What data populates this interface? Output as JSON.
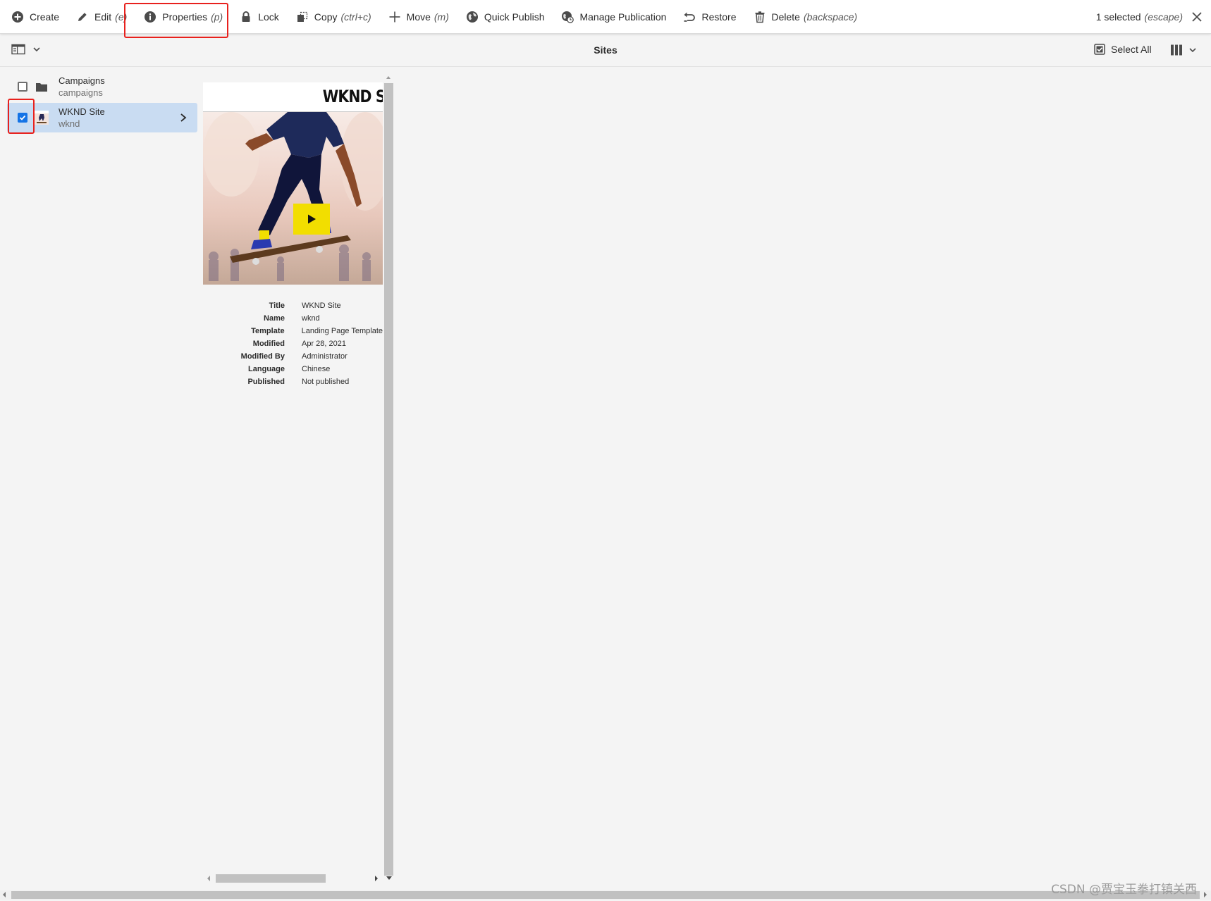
{
  "actionbar": {
    "actions": [
      {
        "label": "Create",
        "hint": ""
      },
      {
        "label": "Edit",
        "hint": "(e)"
      },
      {
        "label": "Properties",
        "hint": "(p)"
      },
      {
        "label": "Lock",
        "hint": ""
      },
      {
        "label": "Copy",
        "hint": "(ctrl+c)"
      },
      {
        "label": "Move",
        "hint": "(m)"
      },
      {
        "label": "Quick Publish",
        "hint": ""
      },
      {
        "label": "Manage Publication",
        "hint": ""
      },
      {
        "label": "Restore",
        "hint": ""
      },
      {
        "label": "Delete",
        "hint": "(backspace)"
      }
    ],
    "selection": {
      "label": "1 selected",
      "hint": "(escape)"
    }
  },
  "titlebar": {
    "title": "Sites",
    "select_all": "Select All"
  },
  "column": {
    "items": [
      {
        "title": "Campaigns",
        "subtitle": "campaigns",
        "checked": false,
        "icon": "folder-icon"
      },
      {
        "title": "WKND Site",
        "subtitle": "wknd",
        "checked": true,
        "icon": "site-thumbnail-icon"
      }
    ]
  },
  "preview": {
    "logo_text": "WKND S",
    "properties": [
      {
        "label": "Title",
        "value": "WKND Site"
      },
      {
        "label": "Name",
        "value": "wknd"
      },
      {
        "label": "Template",
        "value": "Landing Page Template"
      },
      {
        "label": "Modified",
        "value": "Apr 28, 2021"
      },
      {
        "label": "Modified By",
        "value": "Administrator"
      },
      {
        "label": "Language",
        "value": "Chinese"
      },
      {
        "label": "Published",
        "value": "Not published"
      }
    ]
  },
  "watermark": "CSDN @贾宝玉拳打镇关西",
  "colors": {
    "accent": "#1473e6",
    "selected_row": "#c9dcf2",
    "highlight_box": "#e8211d",
    "play_button": "#f2de00"
  }
}
